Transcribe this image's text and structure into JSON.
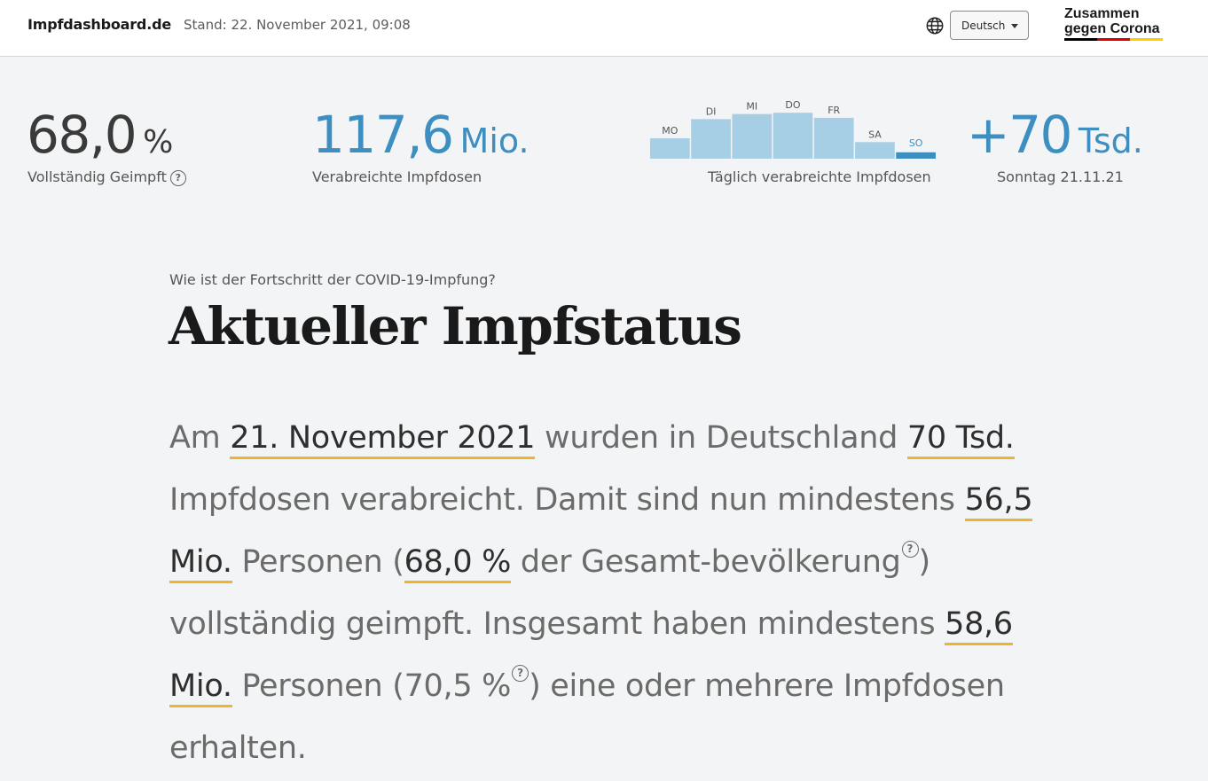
{
  "header": {
    "brand": "Impfdashboard.de",
    "stand": "Stand: 22. November 2021, 09:08",
    "language_selected": "Deutsch",
    "logo_line1": "Zusammen",
    "logo_line2": "gegen Corona",
    "icons": {
      "globe": "globe-icon",
      "caret": "chevron-down-icon"
    },
    "logo_colors": [
      "#000000",
      "#dd0000",
      "#ffcc00"
    ]
  },
  "stats": {
    "fully_vaccinated_value": "68,0",
    "fully_vaccinated_unit": "%",
    "fully_vaccinated_label": "Vollständig Geimpft",
    "doses_value": "117,6",
    "doses_unit": "Mio.",
    "doses_label": "Verabreichte Impfdosen",
    "daily_label": "Täglich verabreichte Impfdosen",
    "latest_value": "+70",
    "latest_unit": "Tsd.",
    "latest_label": "Sonntag 21.11.21",
    "info_icon": "?"
  },
  "chart_data": {
    "type": "bar",
    "title": "",
    "categories": [
      "MO",
      "DI",
      "MI",
      "DO",
      "FR",
      "SA",
      "SO"
    ],
    "values": [
      0.32,
      0.62,
      0.7,
      0.72,
      0.64,
      0.26,
      0.1
    ],
    "highlight_index": 6,
    "colors": {
      "bar": "#a6cfe5",
      "highlight": "#3d8fc1",
      "label": "#555555",
      "label_highlight": "#3d8fc1"
    }
  },
  "main": {
    "kicker": "Wie ist der Fortschritt der COVID-19-Impfung?",
    "title": "Aktueller Impfstatus",
    "p1": "Am ",
    "date": "21. November 2021",
    "p2": " wurden in Deutschland ",
    "daily": "70 Tsd.",
    "p3": " Impfdosen verabreicht. Damit sind nun mindestens ",
    "full_abs": "56,5 Mio.",
    "p4": " Personen (",
    "full_pct": "68,0 %",
    "p5": " der Gesamt-bevölkerung",
    "p6": ") vollständig geimpft. Insgesamt haben mindestens ",
    "partial_abs": "58,6 Mio.",
    "p7": " Personen (70,5 %",
    "p8": ") eine oder mehrere Impfdosen erhalten.",
    "info_icon": "?",
    "accent_color": "#f0b429"
  }
}
